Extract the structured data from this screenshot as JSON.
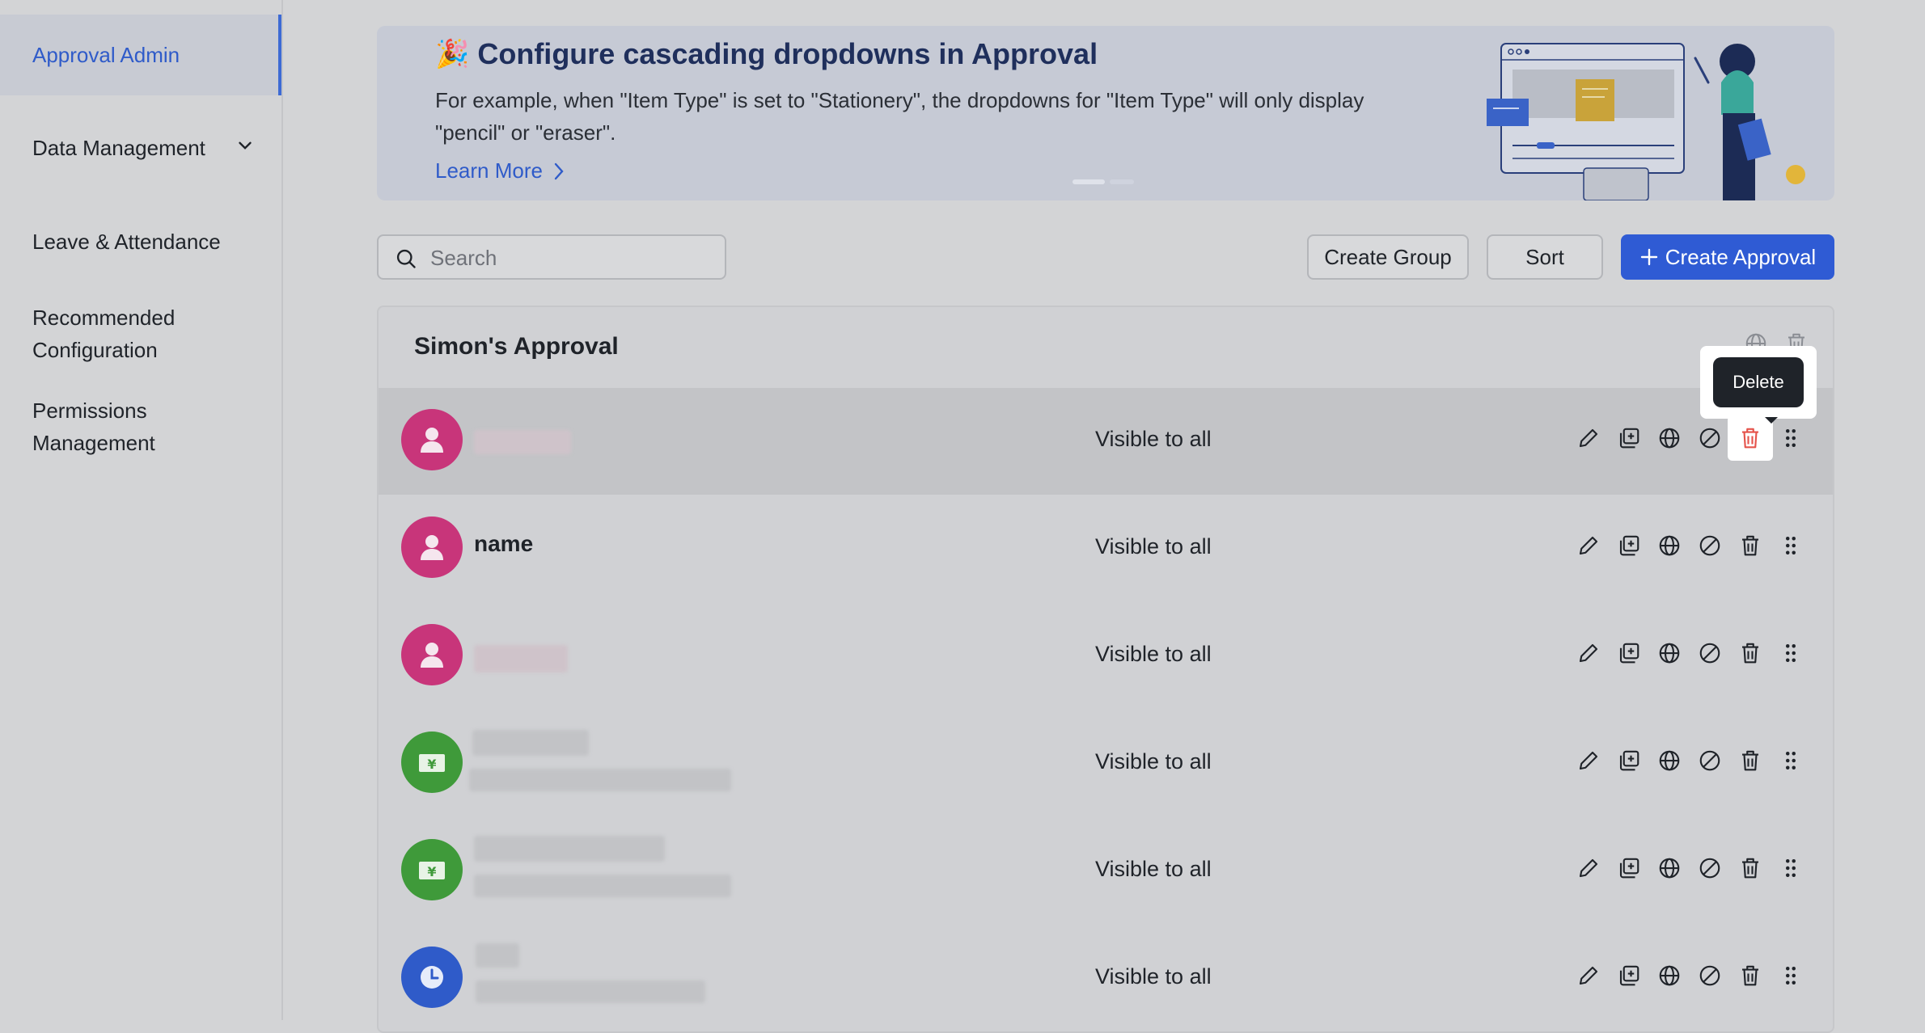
{
  "sidebar": {
    "items": [
      {
        "label": "Approval Admin"
      },
      {
        "label": "Data Management"
      },
      {
        "label": "Leave & Attendance"
      },
      {
        "label": "Recommended Configuration"
      },
      {
        "label": "Permissions Management"
      }
    ]
  },
  "banner": {
    "emoji": "🎉",
    "title": "Configure cascading dropdowns in Approval",
    "description": "For example, when \"Item Type\" is set to \"Stationery\", the dropdowns for \"Item Type\" will only display \"pencil\" or \"eraser\".",
    "learn_more": "Learn More"
  },
  "toolbar": {
    "search_placeholder": "Search",
    "create_group": "Create Group",
    "sort": "Sort",
    "create_approval": "Create Approval"
  },
  "group": {
    "title": "Simon's Approval",
    "rows": [
      {
        "name": "",
        "visibility": "Visible to all",
        "icon": "person-icon",
        "color": "#c8357a"
      },
      {
        "name": "name",
        "visibility": "Visible to all",
        "icon": "person-icon",
        "color": "#c8357a"
      },
      {
        "name": "",
        "visibility": "Visible to all",
        "icon": "person-icon",
        "color": "#c8357a"
      },
      {
        "name": "",
        "visibility": "Visible to all",
        "icon": "yen-icon",
        "color": "#3f9a3a"
      },
      {
        "name": "",
        "visibility": "Visible to all",
        "icon": "yen-icon",
        "color": "#3f9a3a"
      },
      {
        "name": "",
        "visibility": "Visible to all",
        "icon": "clock-icon",
        "color": "#2f5bc9"
      }
    ]
  },
  "tooltip": {
    "text": "Delete"
  },
  "colors": {
    "accent": "#2f5bd4",
    "danger": "#e5534b",
    "overlay": "#d3d4d6"
  }
}
